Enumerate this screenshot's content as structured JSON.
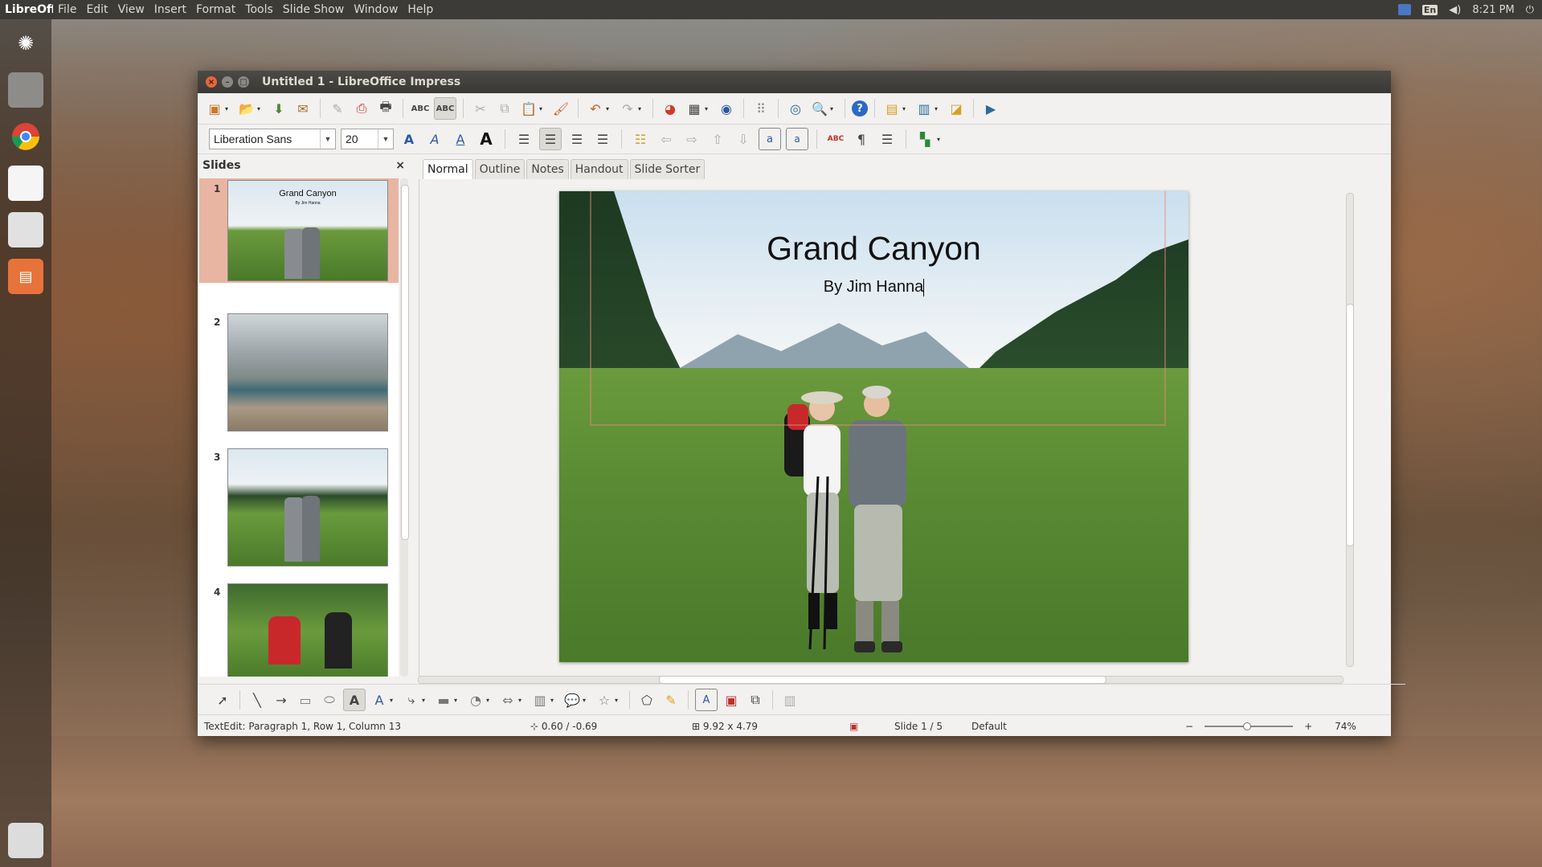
{
  "top_panel": {
    "app_name": "LibreOffi",
    "menu": [
      "File",
      "Edit",
      "View",
      "Insert",
      "Format",
      "Tools",
      "Slide Show",
      "Window",
      "Help"
    ],
    "keyboard": "En",
    "time": "8:21 PM"
  },
  "window": {
    "title": "Untitled 1 - LibreOffice Impress"
  },
  "format_bar": {
    "font_name": "Liberation Sans",
    "font_size": "20"
  },
  "slides_pane": {
    "title": "Slides",
    "close_glyph": "×",
    "thumbs": [
      {
        "num": "1",
        "title": "Grand Canyon",
        "sub": "By Jim Hanna"
      },
      {
        "num": "2"
      },
      {
        "num": "3"
      },
      {
        "num": "4"
      }
    ]
  },
  "view_tabs": [
    "Normal",
    "Outline",
    "Notes",
    "Handout",
    "Slide Sorter"
  ],
  "slide": {
    "title": "Grand Canyon",
    "subtitle": "By Jim Hanna"
  },
  "status": {
    "edit_info": "TextEdit: Paragraph 1, Row 1, Column 13",
    "position": "0.60 / -0.69",
    "size": "9.92 x 4.79",
    "slide": "Slide 1 / 5",
    "layout": "Default",
    "zoom_minus": "−",
    "zoom_plus": "+",
    "zoom": "74%"
  },
  "colors": {
    "accent_orange": "#e9653b",
    "active_thumb": "#e9b5a3",
    "panel": "#3c3b37"
  }
}
